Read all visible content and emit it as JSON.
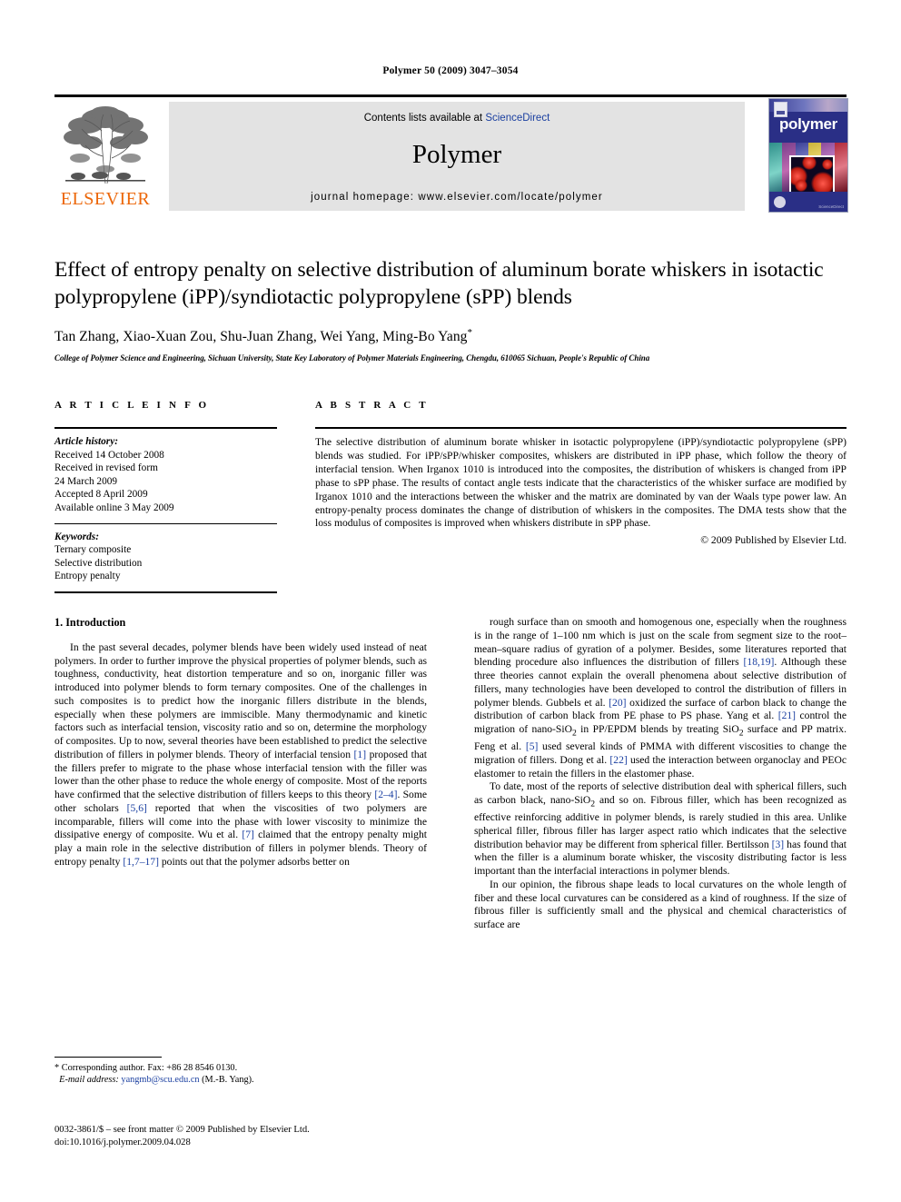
{
  "running_head": "Polymer 50 (2009) 3047–3054",
  "masthead": {
    "contents_prefix": "Contents lists available at ",
    "sciencedirect": "ScienceDirect",
    "journal_title": "Polymer",
    "homepage": "journal homepage: www.elsevier.com/locate/polymer",
    "publisher_name": "ELSEVIER",
    "cover_title": "polymer",
    "cover_footer": "ScienceDirect"
  },
  "title": "Effect of entropy penalty on selective distribution of aluminum borate whiskers in isotactic polypropylene (iPP)/syndiotactic polypropylene (sPP) blends",
  "authors": "Tan Zhang, Xiao-Xuan Zou, Shu-Juan Zhang, Wei Yang, Ming-Bo Yang",
  "author_marker": "*",
  "affiliation": "College of Polymer Science and Engineering, Sichuan University, State Key Laboratory of Polymer Materials Engineering, Chengdu, 610065 Sichuan, People's Republic of China",
  "article_info": {
    "heading": "A R T I C L E   I N F O",
    "history_label": "Article history:",
    "history": [
      "Received 14 October 2008",
      "Received in revised form",
      "24 March 2009",
      "Accepted 8 April 2009",
      "Available online 3 May 2009"
    ],
    "keywords_label": "Keywords:",
    "keywords": [
      "Ternary composite",
      "Selective distribution",
      "Entropy penalty"
    ]
  },
  "abstract": {
    "heading": "A B S T R A C T",
    "text": "The selective distribution of aluminum borate whisker in isotactic polypropylene (iPP)/syndiotactic polypropylene (sPP) blends was studied. For iPP/sPP/whisker composites, whiskers are distributed in iPP phase, which follow the theory of interfacial tension. When Irganox 1010 is introduced into the composites, the distribution of whiskers is changed from iPP phase to sPP phase. The results of contact angle tests indicate that the characteristics of the whisker surface are modified by Irganox 1010 and the interactions between the whisker and the matrix are dominated by van der Waals type power law. An entropy-penalty process dominates the change of distribution of whiskers in the composites. The DMA tests show that the loss modulus of composites is improved when whiskers distribute in sPP phase.",
    "copyright": "© 2009 Published by Elsevier Ltd."
  },
  "body": {
    "section_heading": "1.  Introduction",
    "left_paragraphs": [
      "In the past several decades, polymer blends have been widely used instead of neat polymers. In order to further improve the physical properties of polymer blends, such as toughness, conductivity, heat distortion temperature and so on, inorganic filler was introduced into polymer blends to form ternary composites. One of the challenges in such composites is to predict how the inorganic fillers distribute in the blends, especially when these polymers are immiscible. Many thermodynamic and kinetic factors such as interfacial tension, viscosity ratio and so on, determine the morphology of composites. Up to now, several theories have been established to predict the selective distribution of fillers in polymer blends. Theory of interfacial tension [1] proposed that the fillers prefer to migrate to the phase whose interfacial tension with the filler was lower than the other phase to reduce the whole energy of composite. Most of the reports have confirmed that the selective distribution of fillers keeps to this theory [2–4]. Some other scholars [5,6] reported that when the viscosities of two polymers are incomparable, fillers will come into the phase with lower viscosity to minimize the dissipative energy of composite. Wu et al. [7] claimed that the entropy penalty might play a main role in the selective distribution of fillers in polymer blends. Theory of entropy penalty [1,7–17] points out that the polymer adsorbs better on"
    ],
    "right_paragraphs": [
      "rough surface than on smooth and homogenous one, especially when the roughness is in the range of 1–100 nm which is just on the scale from segment size to the root–mean–square radius of gyration of a polymer. Besides, some literatures reported that blending procedure also influences the distribution of fillers [18,19]. Although these three theories cannot explain the overall phenomena about selective distribution of fillers, many technologies have been developed to control the distribution of fillers in polymer blends. Gubbels et al. [20] oxidized the surface of carbon black to change the distribution of carbon black from PE phase to PS phase. Yang et al. [21] control the migration of nano-SiO2 in PP/EPDM blends by treating SiO2 surface and PP matrix. Feng et al. [5] used several kinds of PMMA with different viscosities to change the migration of fillers. Dong et al. [22] used the interaction between organoclay and PEOc elastomer to retain the fillers in the elastomer phase.",
      "To date, most of the reports of selective distribution deal with spherical fillers, such as carbon black, nano-SiO2 and so on. Fibrous filler, which has been recognized as effective reinforcing additive in polymer blends, is rarely studied in this area. Unlike spherical filler, fibrous filler has larger aspect ratio which indicates that the selective distribution behavior may be different from spherical filler. Bertilsson [3] has found that when the filler is a aluminum borate whisker, the viscosity distributing factor is less important than the interfacial interactions in polymer blends.",
      "In our opinion, the fibrous shape leads to local curvatures on the whole length of fiber and these local curvatures can be considered as a kind of roughness. If the size of fibrous filler is sufficiently small and the physical and chemical characteristics of surface are"
    ]
  },
  "footnote": {
    "corresponding": "* Corresponding author. Fax: +86 28 8546 0130.",
    "email_label": "E-mail address:",
    "email": "yangmb@scu.edu.cn",
    "email_suffix": "(M.-B. Yang)."
  },
  "footer": {
    "issn_line": "0032-3861/$ – see front matter © 2009 Published by Elsevier Ltd.",
    "doi_line": "doi:10.1016/j.polymer.2009.04.028"
  },
  "colors": {
    "link": "#1a3fa0",
    "elsevier_orange": "#ec6608",
    "masthead_bg": "#e3e3e3",
    "cover_blue": "#2a2f86"
  }
}
